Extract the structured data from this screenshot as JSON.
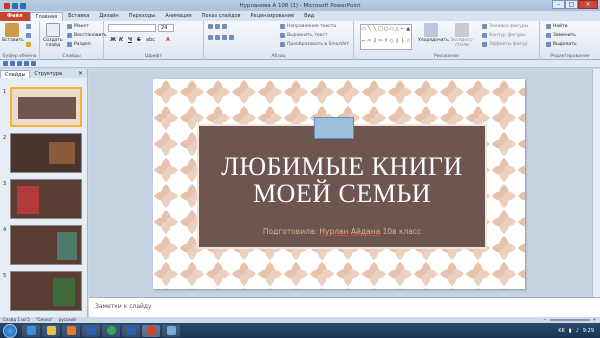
{
  "window": {
    "title": "Нурланова А 10б (1) - Microsoft PowerPoint"
  },
  "tabs": [
    {
      "label": "Файл",
      "type": "file"
    },
    {
      "label": "Главная",
      "active": true
    },
    {
      "label": "Вставка"
    },
    {
      "label": "Дизайн"
    },
    {
      "label": "Переходы"
    },
    {
      "label": "Анимация"
    },
    {
      "label": "Показ слайдов"
    },
    {
      "label": "Рецензирование"
    },
    {
      "label": "Вид"
    }
  ],
  "ribbon": {
    "clipboard": {
      "label": "Буфер обмена",
      "paste": "Вставить"
    },
    "slides": {
      "label": "Слайды",
      "new_slide": "Создать слайд",
      "layout": "Макет",
      "reset": "Восстановить",
      "section": "Раздел"
    },
    "font": {
      "label": "Шрифт",
      "size": "24",
      "bold": "Ж",
      "italic": "К",
      "underline": "Ч",
      "strike": "S",
      "shadow": "abc"
    },
    "paragraph": {
      "label": "Абзац",
      "direction": "Направление текста",
      "align_text": "Выровнять текст",
      "smartart": "Преобразовать в SmartArt"
    },
    "drawing": {
      "label": "Рисование",
      "arrange": "Упорядочить",
      "quick_styles": "Экспресс-стили",
      "fill": "Заливка фигуры",
      "outline": "Контур фигуры",
      "effects": "Эффекты фигур"
    },
    "editing": {
      "label": "Редактирование",
      "find": "Найти",
      "replace": "Заменить",
      "select": "Выделить"
    }
  },
  "panel": {
    "tab_slides": "Слайды",
    "tab_outline": "Структура",
    "close": "×",
    "thumbs": [
      {
        "num": "1"
      },
      {
        "num": "2"
      },
      {
        "num": "3"
      },
      {
        "num": "4"
      },
      {
        "num": "5"
      }
    ]
  },
  "slide": {
    "title_line1": "ЛЮБИМЫЕ КНИГИ",
    "title_line2": "МОЕЙ СЕМЬИ",
    "subtitle_prefix": "Подготовила: ",
    "subtitle_name1": "Нурлан",
    "subtitle_name2": "Айдана",
    "subtitle_suffix": "10в класс"
  },
  "notes": {
    "placeholder": "Заметки к слайду"
  },
  "status": {
    "slide": "Слайд 1 из 5",
    "theme": "\"Смола\"",
    "lang": "русский"
  },
  "taskbar": {
    "lang": "KK",
    "time": "9:29"
  },
  "colors": {
    "file_tab": "#c7462d",
    "slide_brown": "#6e5550",
    "slide_pattern": "#e6c2ad",
    "subtitle": "#d8b49a"
  }
}
